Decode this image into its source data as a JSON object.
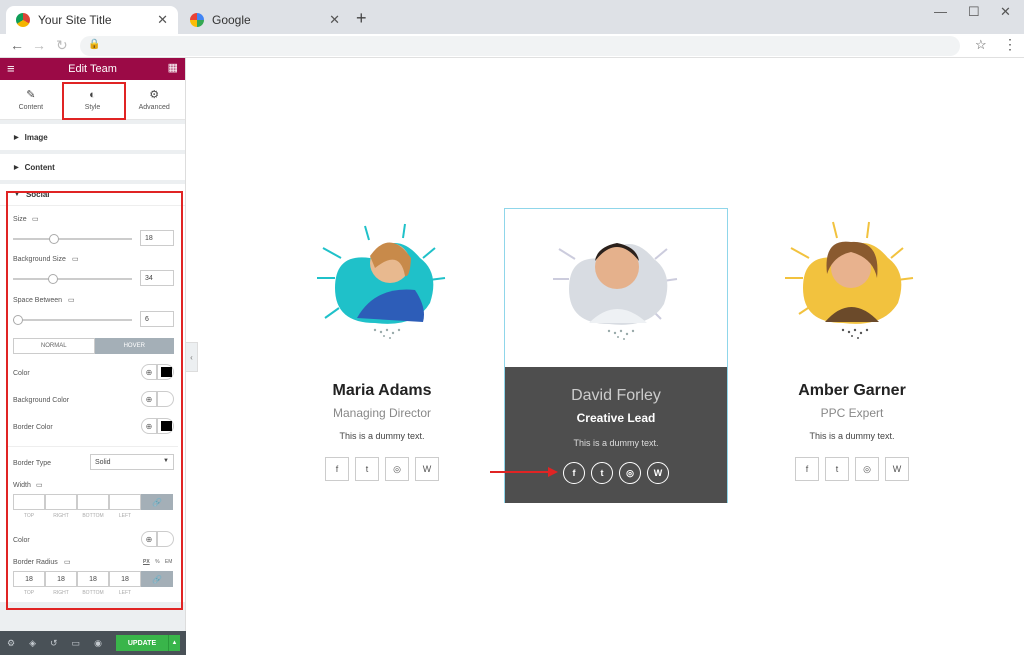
{
  "browser": {
    "tabs": [
      {
        "title": "Your Site Title",
        "active": true
      },
      {
        "title": "Google",
        "active": false
      }
    ],
    "new_tab": "+",
    "close": "✕"
  },
  "editor": {
    "header_title": "Edit Team",
    "tabs": [
      {
        "label": "Content",
        "icon": "pencil-icon"
      },
      {
        "label": "Style",
        "icon": "contrast-icon"
      },
      {
        "label": "Advanced",
        "icon": "gear-icon"
      }
    ],
    "sections": {
      "image": "Image",
      "content": "Content",
      "social": "Social"
    },
    "social": {
      "size_label": "Size",
      "size_value": "18",
      "bg_size_label": "Background Size",
      "bg_size_value": "34",
      "space_label": "Space Between",
      "space_value": "6",
      "toggle_normal": "NORMAL",
      "toggle_hover": "HOVER",
      "color_label": "Color",
      "bg_color_label": "Background Color",
      "border_color_label": "Border Color",
      "border_type_label": "Border Type",
      "border_type_value": "Solid",
      "width_label": "Width",
      "color2_label": "Color",
      "radius_label": "Border Radius",
      "dim_caps": [
        "TOP",
        "RIGHT",
        "BOTTOM",
        "LEFT"
      ],
      "radius_values": [
        "18",
        "18",
        "18",
        "18"
      ],
      "units": [
        "PX",
        "%",
        "EM"
      ]
    },
    "footer": {
      "update_label": "UPDATE"
    }
  },
  "team": [
    {
      "name": "Maria Adams",
      "role": "Managing Director",
      "desc": "This is a dummy text."
    },
    {
      "name": "David Forley",
      "role": "Creative Lead",
      "desc": "This is a dummy text."
    },
    {
      "name": "Amber Garner",
      "role": "PPC Expert",
      "desc": "This is a dummy text."
    }
  ],
  "social_icons": [
    "f",
    "t",
    "◎",
    "W"
  ],
  "colors": {
    "editor_header": "#9b0a46",
    "highlight": "#e02424",
    "update": "#39b54a",
    "hover_card": "#4e4e4e",
    "teal": "#1fc1c9",
    "yellow": "#f2c23e"
  }
}
